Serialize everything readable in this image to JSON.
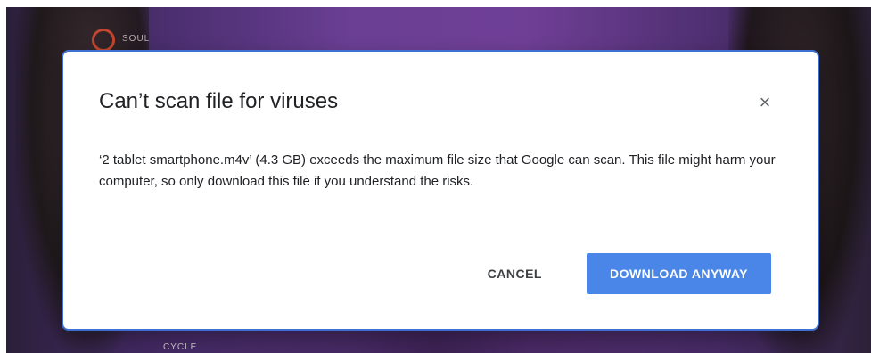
{
  "background": {
    "brand_text": "SOUL",
    "bottom_label": "CYCLE"
  },
  "dialog": {
    "title": "Can’t scan file for viruses",
    "close_glyph": "×",
    "message": "‘2 tablet smartphone.m4v’ (4.3 GB) exceeds the maximum file size that Google can scan. This file might harm your computer, so only download this file if you understand the risks.",
    "cancel_label": "CANCEL",
    "download_label": "DOWNLOAD ANYWAY"
  },
  "colors": {
    "primary_button": "#4a86e8",
    "focus_border": "#3f6fd1"
  },
  "icons": {
    "close": "close-icon"
  }
}
